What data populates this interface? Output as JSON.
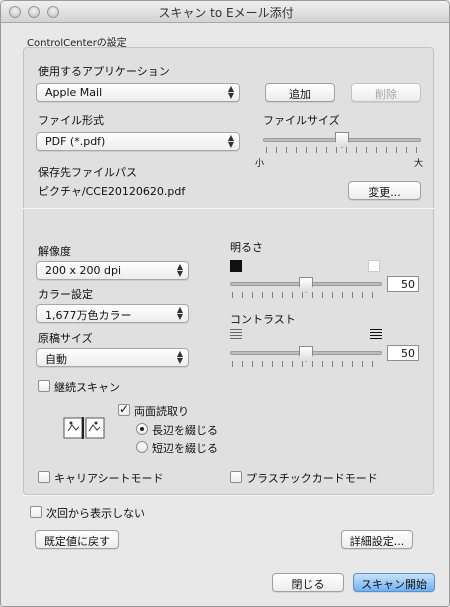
{
  "window": {
    "title": "スキャン to Eメール添付"
  },
  "group": {
    "label": "ControlCenterの設定"
  },
  "app_section": {
    "label": "使用するアプリケーション",
    "selected": "Apple Mail",
    "add_label": "追加",
    "delete_label": "削除"
  },
  "file_format": {
    "label": "ファイル形式",
    "selected": "PDF (*.pdf)"
  },
  "file_size": {
    "label": "ファイルサイズ",
    "min_label": "小",
    "max_label": "大",
    "level": 0.5
  },
  "save_path": {
    "label": "保存先ファイルパス",
    "value": "ピクチャ/CCE20120620.pdf",
    "change_label": "変更..."
  },
  "resolution": {
    "label": "解像度",
    "selected": "200 x 200 dpi"
  },
  "color": {
    "label": "カラー設定",
    "selected": "1,677万色カラー"
  },
  "doc_size": {
    "label": "原稿サイズ",
    "selected": "自動"
  },
  "brightness": {
    "label": "明るさ",
    "value": "50",
    "level": 0.5
  },
  "contrast": {
    "label": "コントラスト",
    "value": "50",
    "level": 0.5
  },
  "continuous_scan": {
    "label": "継続スキャン",
    "checked": false
  },
  "duplex": {
    "label": "両面読取り",
    "checked": true,
    "options": [
      "長辺を綴じる",
      "短辺を綴じる"
    ],
    "selected_index": 0
  },
  "carrier_sheet": {
    "label": "キャリアシートモード",
    "checked": false
  },
  "plastic_card": {
    "label": "プラスチックカードモード",
    "checked": false
  },
  "dont_show": {
    "label": "次回から表示しない",
    "checked": false
  },
  "buttons": {
    "restore_defaults": "既定値に戻す",
    "advanced": "詳細設定...",
    "close": "閉じる",
    "start_scan": "スキャン開始"
  },
  "colors": {
    "accent": "#6fb2f3",
    "window_bg": "#e8e8e8"
  },
  "icons": [
    "close-icon",
    "minimize-icon",
    "zoom-icon",
    "popup-arrows-icon",
    "brightness-dark-icon",
    "brightness-light-icon",
    "contrast-low-icon",
    "contrast-high-icon",
    "duplex-binding-icon"
  ]
}
